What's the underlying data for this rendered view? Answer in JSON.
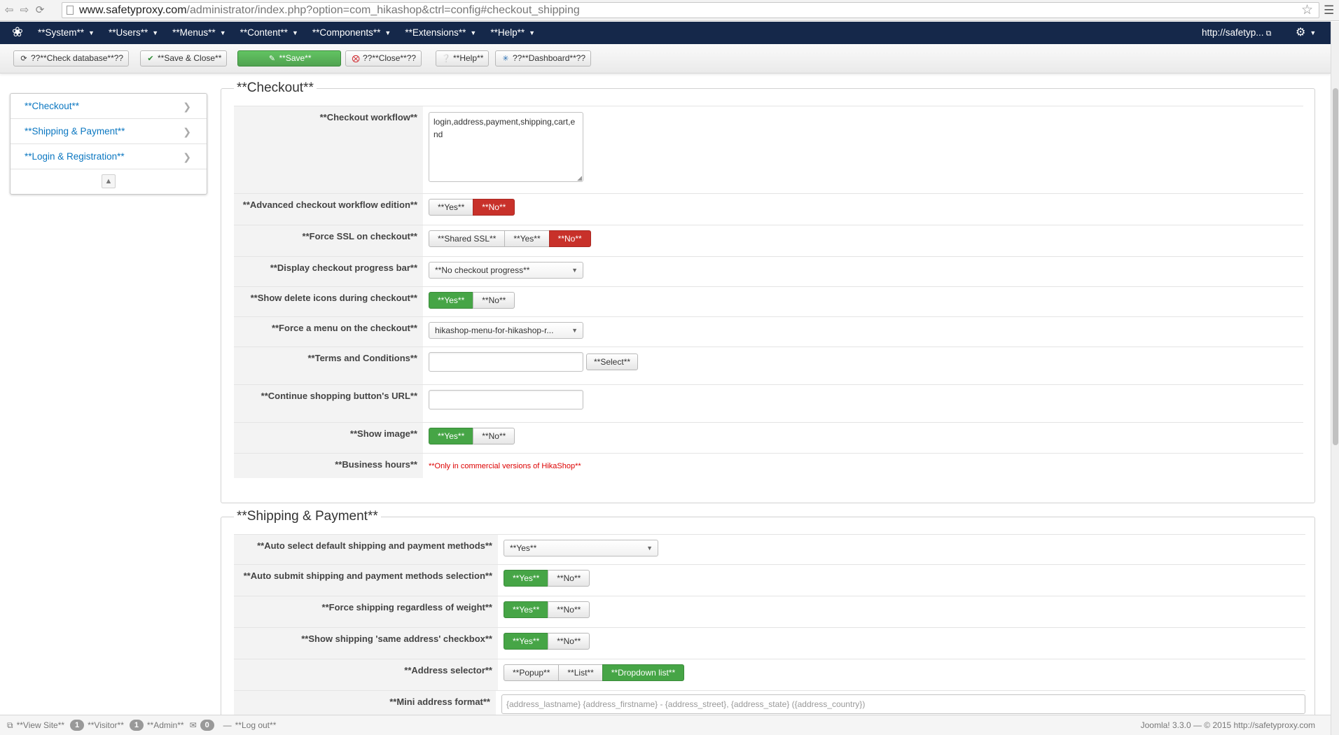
{
  "browser": {
    "url_domain": "www.safetyproxy.com",
    "url_path": "/administrator/index.php?option=com_hikashop&ctrl=config#checkout_shipping"
  },
  "topnav": {
    "menu": [
      "**System**",
      "**Users**",
      "**Menus**",
      "**Content**",
      "**Components**",
      "**Extensions**",
      "**Help**"
    ],
    "site_link": "http://safetyp..."
  },
  "toolbar": {
    "check_database": "??**Check database**??",
    "save_close": "**Save & Close**",
    "save": "**Save**",
    "close": "??**Close**??",
    "help": "**Help**",
    "dashboard": "??**Dashboard**??"
  },
  "left_menu": {
    "items": [
      "**Checkout**",
      "**Shipping & Payment**",
      "**Login & Registration**"
    ]
  },
  "checkout": {
    "legend": "**Checkout**",
    "workflow_label": "**Checkout workflow**",
    "workflow_value": "login,address,payment,shipping,cart,end",
    "advanced_label": "**Advanced checkout workflow edition**",
    "advanced_options": [
      "**Yes**",
      "**No**"
    ],
    "advanced_selected": "**No**",
    "ssl_label": "**Force SSL on checkout**",
    "ssl_options": [
      "**Shared SSL**",
      "**Yes**",
      "**No**"
    ],
    "ssl_selected": "**No**",
    "progress_label": "**Display checkout progress bar**",
    "progress_value": "**No checkout progress**",
    "delete_icons_label": "**Show delete icons during checkout**",
    "delete_icons_options": [
      "**Yes**",
      "**No**"
    ],
    "delete_icons_selected": "**Yes**",
    "force_menu_label": "**Force a menu on the checkout**",
    "force_menu_value": "hikashop-menu-for-hikashop-r...",
    "terms_label": "**Terms and Conditions**",
    "terms_value": "",
    "terms_button": "**Select**",
    "continue_label": "**Continue shopping button's URL**",
    "continue_value": "",
    "show_image_label": "**Show image**",
    "show_image_options": [
      "**Yes**",
      "**No**"
    ],
    "show_image_selected": "**Yes**",
    "business_hours_label": "**Business hours**",
    "business_hours_note": "**Only in commercial versions of HikaShop**"
  },
  "shipping": {
    "legend": "**Shipping & Payment**",
    "auto_select_label": "**Auto select default shipping and payment methods**",
    "auto_select_value": "**Yes**",
    "auto_submit_label": "**Auto submit shipping and payment methods selection**",
    "auto_submit_options": [
      "**Yes**",
      "**No**"
    ],
    "auto_submit_selected": "**Yes**",
    "force_weight_label": "**Force shipping regardless of weight**",
    "force_weight_options": [
      "**Yes**",
      "**No**"
    ],
    "force_weight_selected": "**Yes**",
    "same_address_label": "**Show shipping 'same address' checkbox**",
    "same_address_options": [
      "**Yes**",
      "**No**"
    ],
    "same_address_selected": "**Yes**",
    "address_selector_label": "**Address selector**",
    "address_selector_options": [
      "**Popup**",
      "**List**",
      "**Dropdown list**"
    ],
    "address_selector_selected": "**Dropdown list**",
    "mini_format_label": "**Mini address format**",
    "mini_format_value": "{address_lastname} {address_firstname} - {address_street}, {address_state} ({address_country})"
  },
  "status": {
    "view_site": "**View Site**",
    "visitor_count": "1",
    "visitor": "**Visitor**",
    "admin_count": "1",
    "admin": "**Admin**",
    "messages_count": "0",
    "logout": "**Log out**",
    "footer": "Joomla! 3.3.0  —  © 2015 http://safetyproxy.com"
  },
  "colors": {
    "nav_bg": "#15284a",
    "active_red": "#c8312a",
    "active_green": "#46a546",
    "link_blue": "#0b77c1"
  }
}
